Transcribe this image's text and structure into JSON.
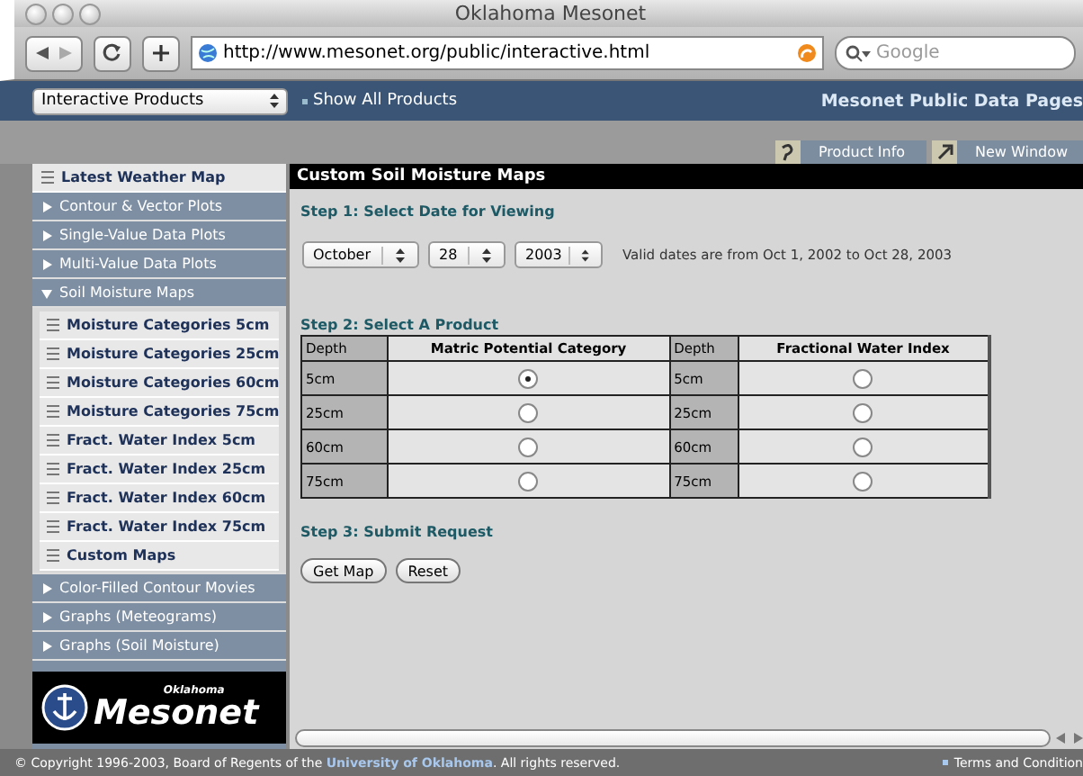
{
  "window": {
    "title": "Oklahoma Mesonet"
  },
  "toolbar": {
    "url": "http://www.mesonet.org/public/interactive.html",
    "search": {
      "placeholder": "Google"
    }
  },
  "site_nav": {
    "product_select": "Interactive Products",
    "show_all_link": "Show All Products",
    "site_title": "Mesonet Public Data Pages"
  },
  "action_buttons": [
    "Product Info",
    "New Window"
  ],
  "sidebar": {
    "items": [
      {
        "kind": "link",
        "label": "Latest Weather Map"
      },
      {
        "kind": "folder",
        "label": "Contour & Vector Plots",
        "expanded": false
      },
      {
        "kind": "folder",
        "label": "Single-Value Data Plots",
        "expanded": false
      },
      {
        "kind": "folder",
        "label": "Multi-Value Data Plots",
        "expanded": false
      },
      {
        "kind": "folder",
        "label": "Soil Moisture Maps",
        "expanded": true,
        "children": [
          {
            "kind": "link",
            "label": "Moisture Categories 5cm"
          },
          {
            "kind": "link",
            "label": "Moisture Categories 25cm"
          },
          {
            "kind": "link",
            "label": "Moisture Categories 60cm"
          },
          {
            "kind": "link",
            "label": "Moisture Categories 75cm"
          },
          {
            "kind": "link",
            "label": "Fract. Water Index 5cm"
          },
          {
            "kind": "link",
            "label": "Fract. Water Index 25cm"
          },
          {
            "kind": "link",
            "label": "Fract. Water Index 60cm"
          },
          {
            "kind": "link",
            "label": "Fract. Water Index 75cm"
          },
          {
            "kind": "link",
            "label": "Custom Maps"
          }
        ]
      },
      {
        "kind": "folder",
        "label": "Color-Filled Contour Movies",
        "expanded": false
      },
      {
        "kind": "folder",
        "label": "Graphs (Meteograms)",
        "expanded": false
      },
      {
        "kind": "folder",
        "label": "Graphs (Soil Moisture)",
        "expanded": false
      }
    ],
    "logo": {
      "small": "Oklahoma",
      "large": "Mesonet"
    }
  },
  "content": {
    "title": "Custom Soil Moisture Maps",
    "step1": {
      "heading": "Step 1: Select Date for Viewing",
      "month": "October",
      "day": "28",
      "year": "2003",
      "note": "Valid dates are from Oct 1, 2002 to Oct 28, 2003"
    },
    "step2": {
      "heading": "Step 2: Select A Product",
      "columns": [
        "Depth",
        "Matric Potential Category",
        "Depth",
        "Fractional Water Index"
      ],
      "rows": [
        {
          "depth_left": "5cm",
          "matric": {
            "selected": true
          },
          "depth_right": "5cm",
          "fractional": {
            "selected": false
          }
        },
        {
          "depth_left": "25cm",
          "matric": {
            "selected": false
          },
          "depth_right": "25cm",
          "fractional": {
            "selected": false
          }
        },
        {
          "depth_left": "60cm",
          "matric": {
            "selected": false
          },
          "depth_right": "60cm",
          "fractional": {
            "selected": false
          }
        },
        {
          "depth_left": "75cm",
          "matric": {
            "selected": false
          },
          "depth_right": "75cm",
          "fractional": {
            "selected": false
          }
        }
      ]
    },
    "step3": {
      "heading": "Step 3: Submit Request",
      "buttons": [
        "Get Map",
        "Reset"
      ]
    }
  },
  "footer": {
    "copyright_before": "© Copyright 1996-2003, Board of Regents of the ",
    "university_link": "University of Oklahoma",
    "copyright_after": ". All rights reserved.",
    "terms_link": "Terms and Condition"
  }
}
